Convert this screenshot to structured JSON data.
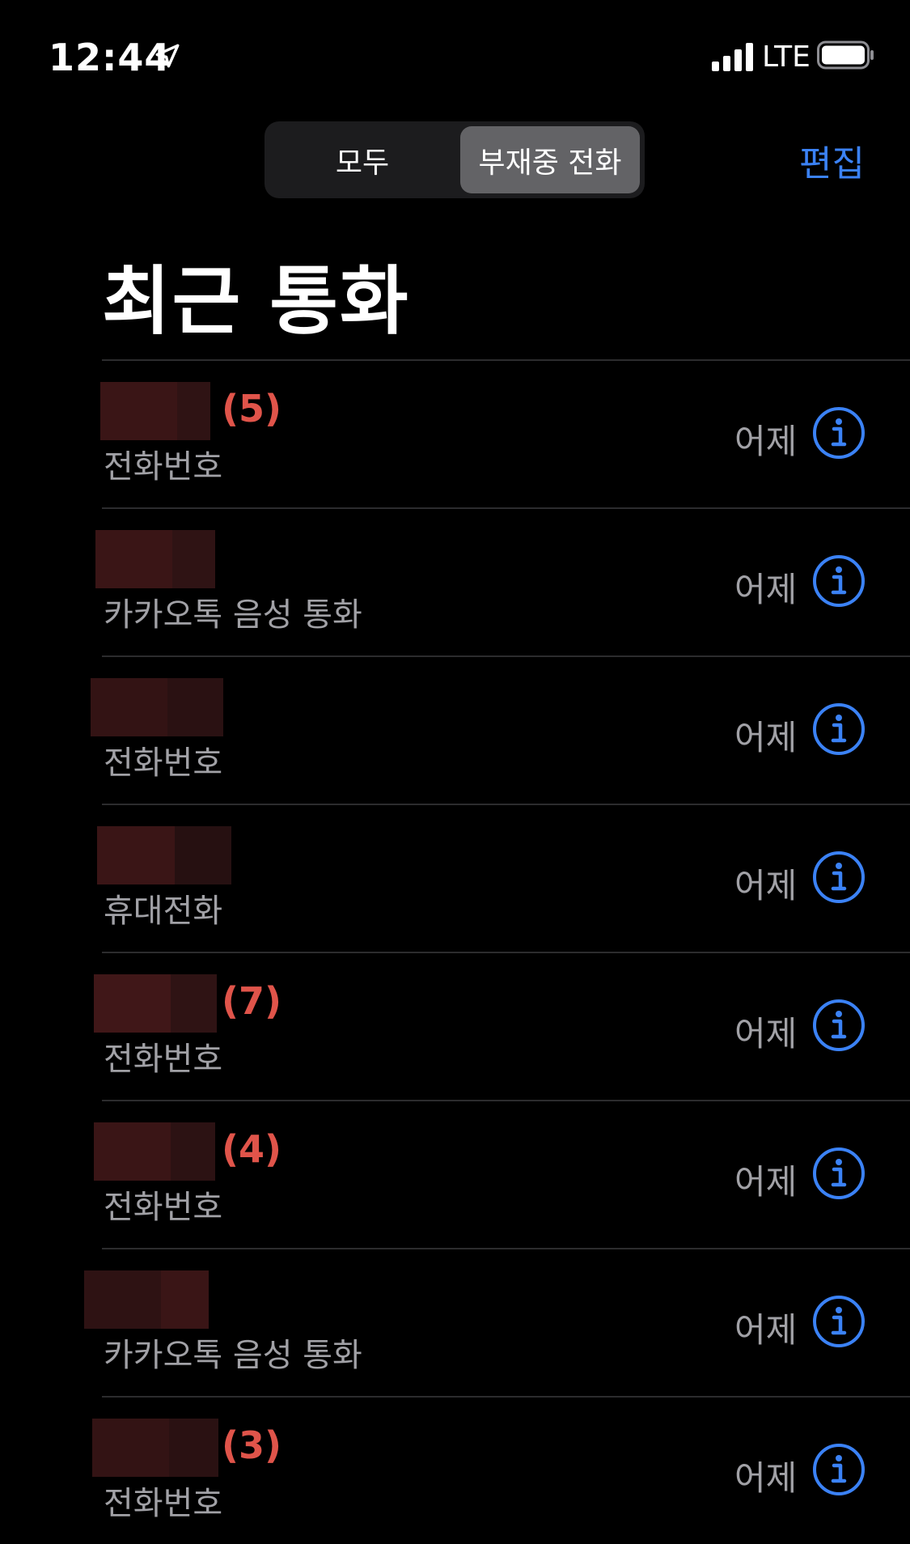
{
  "status_bar": {
    "time": "12:44",
    "network": "LTE"
  },
  "segmented": {
    "all_label": "모두",
    "missed_label": "부재중 전화",
    "selected": "missed"
  },
  "header": {
    "edit_label": "편집",
    "title": "최근 통화"
  },
  "colors": {
    "accent": "#3b82f6",
    "missed": "#e0544a",
    "secondary_text": "#a1a1a6",
    "background": "#000000"
  },
  "calls": [
    {
      "count": "(5)",
      "type": "전화번호",
      "date": "어제"
    },
    {
      "count": "",
      "type": "카카오톡 음성 통화",
      "date": "어제"
    },
    {
      "count": "",
      "type": "전화번호",
      "date": "어제"
    },
    {
      "count": "",
      "type": "휴대전화",
      "date": "어제"
    },
    {
      "count": "(7)",
      "type": "전화번호",
      "date": "어제"
    },
    {
      "count": "(4)",
      "type": "전화번호",
      "date": "어제"
    },
    {
      "count": "",
      "type": "카카오톡 음성 통화",
      "date": "어제"
    },
    {
      "count": "(3)",
      "type": "전화번호",
      "date": "어제"
    }
  ]
}
